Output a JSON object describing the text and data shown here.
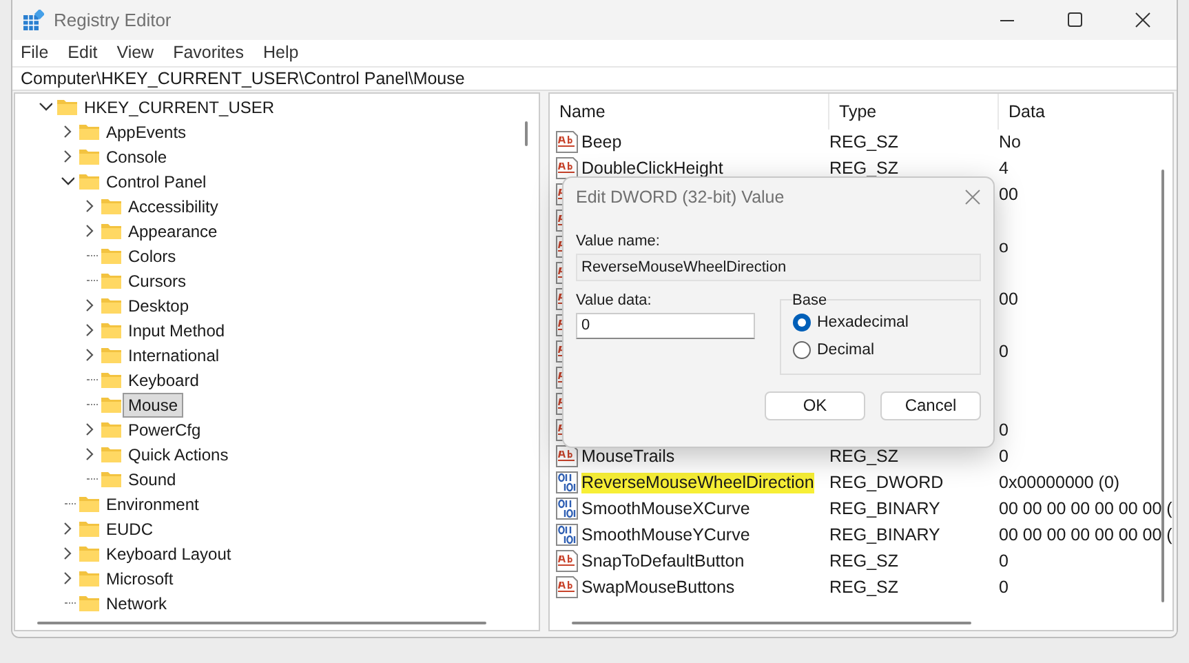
{
  "window": {
    "title": "Registry Editor"
  },
  "menu": [
    "File",
    "Edit",
    "View",
    "Favorites",
    "Help"
  ],
  "address": "Computer\\HKEY_CURRENT_USER\\Control Panel\\Mouse",
  "tree": [
    {
      "label": "HKEY_CURRENT_USER",
      "expanded": true,
      "selected": false,
      "children": [
        {
          "label": "AppEvents",
          "expanded": false,
          "selected": false
        },
        {
          "label": "Console",
          "expanded": false,
          "selected": false
        },
        {
          "label": "Control Panel",
          "expanded": true,
          "selected": false,
          "children": [
            {
              "label": "Accessibility",
              "expanded": false,
              "selected": false
            },
            {
              "label": "Appearance",
              "expanded": false,
              "selected": false
            },
            {
              "label": "Colors",
              "selected": false
            },
            {
              "label": "Cursors",
              "selected": false
            },
            {
              "label": "Desktop",
              "expanded": false,
              "selected": false
            },
            {
              "label": "Input Method",
              "expanded": false,
              "selected": false
            },
            {
              "label": "International",
              "expanded": false,
              "selected": false
            },
            {
              "label": "Keyboard",
              "selected": false
            },
            {
              "label": "Mouse",
              "selected": true
            },
            {
              "label": "PowerCfg",
              "expanded": false,
              "selected": false
            },
            {
              "label": "Quick Actions",
              "expanded": false,
              "selected": false
            },
            {
              "label": "Sound",
              "selected": false
            }
          ]
        },
        {
          "label": "Environment",
          "selected": false
        },
        {
          "label": "EUDC",
          "expanded": false,
          "selected": false
        },
        {
          "label": "Keyboard Layout",
          "expanded": false,
          "selected": false
        },
        {
          "label": "Microsoft",
          "expanded": false,
          "selected": false
        },
        {
          "label": "Network",
          "selected": false
        }
      ]
    }
  ],
  "columns": [
    "Name",
    "Type",
    "Data"
  ],
  "rows": [
    {
      "kind": "string",
      "name": "Beep",
      "type": "REG_SZ",
      "data": "No",
      "highlighted": false
    },
    {
      "kind": "string",
      "name": "DoubleClickHeight",
      "type": "REG_SZ",
      "data": "4",
      "highlighted": false
    },
    {
      "kind": "string",
      "data": "00"
    },
    {
      "kind": "string"
    },
    {
      "kind": "string",
      "data": "o"
    },
    {
      "kind": "string"
    },
    {
      "kind": "string",
      "data": "00"
    },
    {
      "kind": "string"
    },
    {
      "kind": "string",
      "data": "0"
    },
    {
      "kind": "string"
    },
    {
      "kind": "string"
    },
    {
      "kind": "string",
      "data": "0"
    },
    {
      "kind": "string",
      "name": "MouseTrails",
      "type": "REG_SZ",
      "data": "0",
      "highlighted": false
    },
    {
      "kind": "binary",
      "name": "ReverseMouseWheelDirection",
      "type": "REG_DWORD",
      "data": "0x00000000 (0)",
      "highlighted": true
    },
    {
      "kind": "binary",
      "name": "SmoothMouseXCurve",
      "type": "REG_BINARY",
      "data": "00 00 00 00 00 00 00 (",
      "highlighted": false
    },
    {
      "kind": "binary",
      "name": "SmoothMouseYCurve",
      "type": "REG_BINARY",
      "data": "00 00 00 00 00 00 00 (",
      "highlighted": false
    },
    {
      "kind": "string",
      "name": "SnapToDefaultButton",
      "type": "REG_SZ",
      "data": "0",
      "highlighted": false
    },
    {
      "kind": "string",
      "name": "SwapMouseButtons",
      "type": "REG_SZ",
      "data": "0",
      "highlighted": false
    }
  ],
  "dialog": {
    "title": "Edit DWORD (32-bit) Value",
    "value_name_label": "Value name:",
    "value_name": "ReverseMouseWheelDirection",
    "value_data_label": "Value data:",
    "value_data": "0",
    "base_label": "Base",
    "base_options": [
      {
        "label": "Hexadecimal",
        "selected": true
      },
      {
        "label": "Decimal",
        "selected": false
      }
    ],
    "buttons": [
      "OK",
      "Cancel"
    ]
  }
}
